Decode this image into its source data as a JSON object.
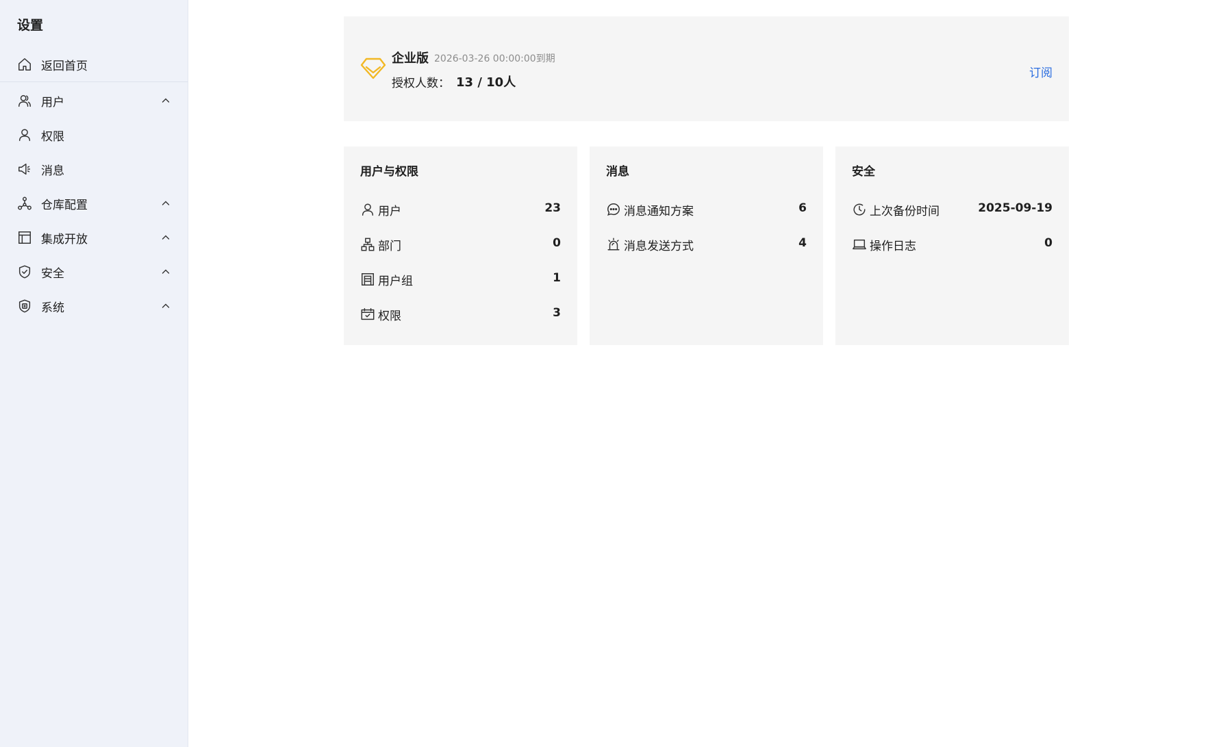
{
  "sidebar": {
    "title": "设置",
    "items": [
      {
        "label": "返回首页",
        "icon": "home-icon",
        "expandable": false
      },
      {
        "label": "用户",
        "icon": "users-icon",
        "expandable": true
      },
      {
        "label": "权限",
        "icon": "user-icon",
        "expandable": false
      },
      {
        "label": "消息",
        "icon": "megaphone-icon",
        "expandable": false
      },
      {
        "label": "仓库配置",
        "icon": "share-nodes-icon",
        "expandable": true
      },
      {
        "label": "集成开放",
        "icon": "layout-icon",
        "expandable": true
      },
      {
        "label": "安全",
        "icon": "shield-check-icon",
        "expandable": true
      },
      {
        "label": "系统",
        "icon": "system-badge-icon",
        "expandable": true
      }
    ]
  },
  "license": {
    "edition": "企业版",
    "expiry": "2026-03-26 00:00:00到期",
    "seats_label": "授权人数：",
    "seats_value": "13 / 10人",
    "subscribe_label": "订阅",
    "icon": "diamond-icon",
    "icon_color": "#f2b824"
  },
  "cards": {
    "users_permissions": {
      "title": "用户与权限",
      "rows": [
        {
          "label": "用户",
          "value": "23",
          "icon": "user-icon"
        },
        {
          "label": "部门",
          "value": "0",
          "icon": "org-chart-icon"
        },
        {
          "label": "用户组",
          "value": "1",
          "icon": "building-icon"
        },
        {
          "label": "权限",
          "value": "3",
          "icon": "calendar-check-icon"
        }
      ]
    },
    "messages": {
      "title": "消息",
      "rows": [
        {
          "label": "消息通知方案",
          "value": "6",
          "icon": "chat-bubble-icon"
        },
        {
          "label": "消息发送方式",
          "value": "4",
          "icon": "alarm-icon"
        }
      ]
    },
    "security": {
      "title": "安全",
      "rows": [
        {
          "label": "上次备份时间",
          "value": "2025-09-19",
          "icon": "clock-icon"
        },
        {
          "label": "操作日志",
          "value": "0",
          "icon": "laptop-icon"
        }
      ]
    }
  },
  "colors": {
    "sidebar_bg": "#eff2f9",
    "card_bg": "#f5f5f5",
    "link": "#2b6de0",
    "muted": "#8c8c8c"
  }
}
